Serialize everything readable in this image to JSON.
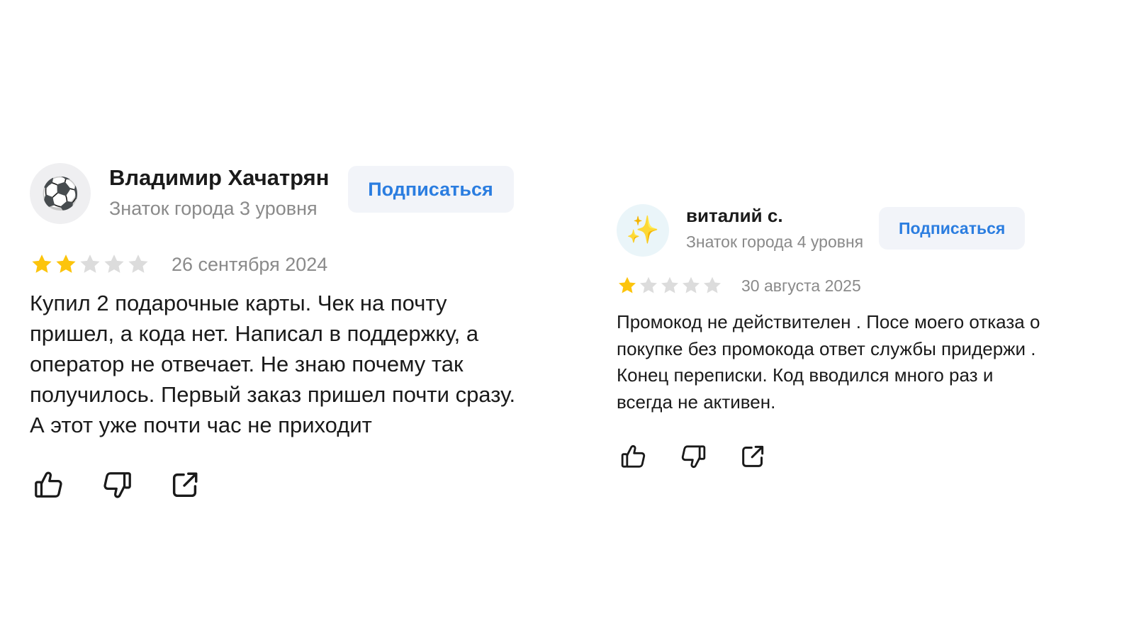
{
  "reviews": [
    {
      "avatar_emoji": "⚽",
      "author_name": "Владимир Хачатрян",
      "author_level": "Знаток города 3 уровня",
      "subscribe_label": "Подписаться",
      "rating": 2,
      "rating_max": 5,
      "date": "26 сентября 2024",
      "text": "Купил 2 подарочные карты. Чек на почту пришел, а кода нет. Написал в поддержку, а оператор не отвечает. Не знаю почему так получилось. Первый заказ пришел почти сразу. А этот уже почти час не приходит",
      "actions": [
        "thumbs-up-icon",
        "thumbs-down-icon",
        "share-icon"
      ]
    },
    {
      "avatar_emoji": "✨",
      "author_name": "виталий с.",
      "author_level": "Знаток города 4 уровня",
      "subscribe_label": "Подписаться",
      "rating": 1,
      "rating_max": 5,
      "date": "30 августа 2025",
      "text": "Промокод не действителен . Посе моего отказа о покупке без промокода ответ службы придержи . Конец переписки. Код вводился много раз и всегда не активен.",
      "actions": [
        "thumbs-up-icon",
        "thumbs-down-icon",
        "share-icon"
      ]
    }
  ],
  "colors": {
    "star_filled": "#fcc40c",
    "star_empty": "#dcdcdc",
    "accent": "#2b7de0",
    "button_bg": "#f2f4f9",
    "muted_text": "#8a8a8a"
  }
}
